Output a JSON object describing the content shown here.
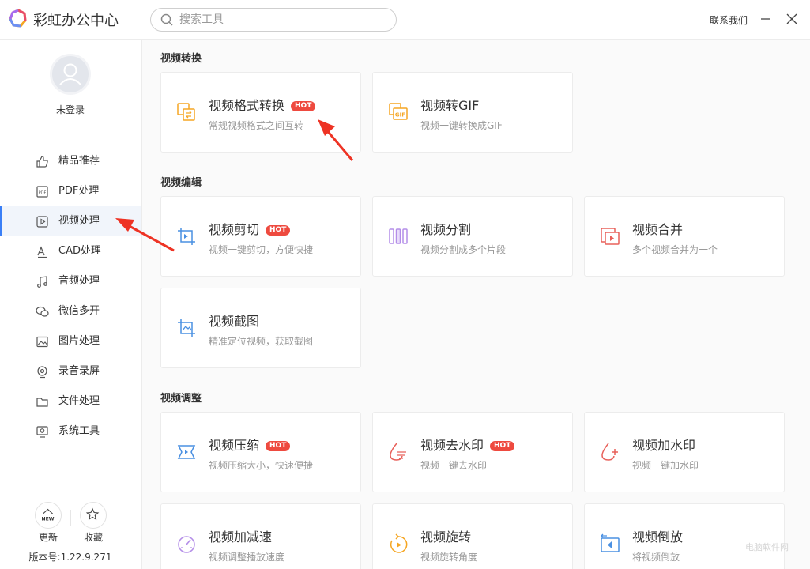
{
  "app": {
    "title": "彩虹办公中心",
    "contact": "联系我们"
  },
  "search": {
    "placeholder": "搜索工具",
    "value": ""
  },
  "sidebar": {
    "login_text": "未登录",
    "items": [
      {
        "label": "精品推荐",
        "icon": "thumbs-up-icon"
      },
      {
        "label": "PDF处理",
        "icon": "pdf-icon"
      },
      {
        "label": "视频处理",
        "icon": "video-icon",
        "active": true
      },
      {
        "label": "CAD处理",
        "icon": "cad-icon"
      },
      {
        "label": "音频处理",
        "icon": "music-icon"
      },
      {
        "label": "微信多开",
        "icon": "wechat-icon"
      },
      {
        "label": "图片处理",
        "icon": "image-icon"
      },
      {
        "label": "录音录屏",
        "icon": "record-icon"
      },
      {
        "label": "文件处理",
        "icon": "folder-icon"
      },
      {
        "label": "系统工具",
        "icon": "system-icon"
      }
    ],
    "update_label": "更新",
    "update_badge": "NEW",
    "favorite_label": "收藏",
    "version": "版本号:1.22.9.271"
  },
  "sections": [
    {
      "title": "视频转换",
      "cards": [
        {
          "title": "视频格式转换",
          "desc": "常规视频格式之间互转",
          "hot": "HOT",
          "icon": "video-convert-icon"
        },
        {
          "title": "视频转GIF",
          "desc": "视频一键转换成GIF",
          "icon": "gif-icon",
          "icon_text": "GIF"
        }
      ]
    },
    {
      "title": "视频编辑",
      "cards": [
        {
          "title": "视频剪切",
          "desc": "视频一键剪切，方便快捷",
          "hot": "HOT",
          "icon": "crop-icon"
        },
        {
          "title": "视频分割",
          "desc": "视频分割成多个片段",
          "icon": "split-icon"
        },
        {
          "title": "视频合并",
          "desc": "多个视频合并为一个",
          "icon": "merge-icon"
        },
        {
          "title": "视频截图",
          "desc": "精准定位视频，获取截图",
          "icon": "screenshot-icon"
        }
      ]
    },
    {
      "title": "视频调整",
      "cards": [
        {
          "title": "视频压缩",
          "desc": "视频压缩大小，快速便捷",
          "hot": "HOT",
          "icon": "compress-icon"
        },
        {
          "title": "视频去水印",
          "desc": "视频一键去水印",
          "hot": "HOT",
          "icon": "remove-watermark-icon"
        },
        {
          "title": "视频加水印",
          "desc": "视频一键加水印",
          "icon": "add-watermark-icon"
        },
        {
          "title": "视频加减速",
          "desc": "视频调整播放速度",
          "icon": "speed-icon"
        },
        {
          "title": "视频旋转",
          "desc": "视频旋转角度",
          "icon": "rotate-icon"
        },
        {
          "title": "视频倒放",
          "desc": "将视频倒放",
          "icon": "reverse-icon"
        }
      ]
    }
  ],
  "watermark": "电脑软件网",
  "colors": {
    "accent": "#3a7ff6",
    "hot": "#ee4a3f",
    "orange": "#f5a623",
    "purple": "#b48ee8",
    "red": "#e8605a",
    "blue": "#4a90e2",
    "arrow": "#ee3324"
  }
}
